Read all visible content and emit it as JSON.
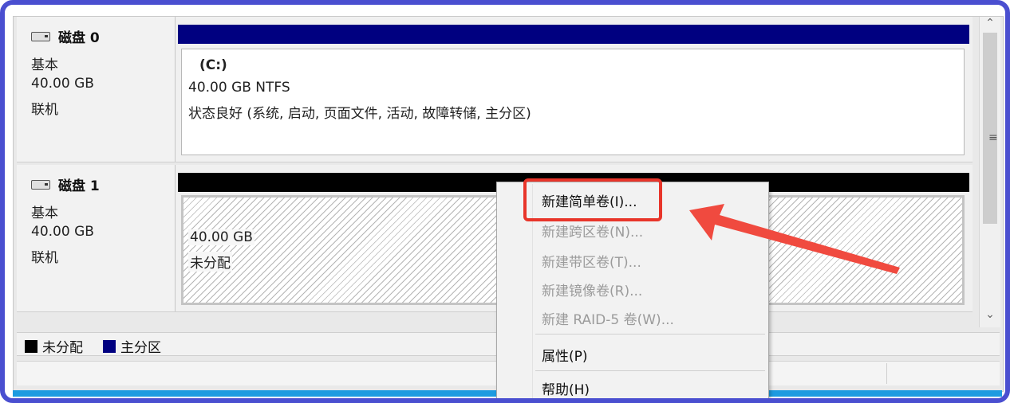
{
  "disks": [
    {
      "title": "磁盘 0",
      "type": "基本",
      "size": "40.00 GB",
      "status": "联机",
      "volume": {
        "name": "(C:)",
        "size_fs": "40.00 GB NTFS",
        "health": "状态良好 (系统, 启动, 页面文件, 活动, 故障转储, 主分区)"
      }
    },
    {
      "title": "磁盘 1",
      "type": "基本",
      "size": "40.00 GB",
      "status": "联机",
      "volume": {
        "size": "40.00 GB",
        "state": "未分配"
      }
    }
  ],
  "legend": [
    {
      "label": "未分配",
      "color": "#000000"
    },
    {
      "label": "主分区",
      "color": "#000080"
    }
  ],
  "context_menu": {
    "items": [
      {
        "label": "新建简单卷(I)...",
        "enabled": true,
        "highlighted": true
      },
      {
        "label": "新建跨区卷(N)...",
        "enabled": false
      },
      {
        "label": "新建带区卷(T)...",
        "enabled": false
      },
      {
        "label": "新建镜像卷(R)...",
        "enabled": false
      },
      {
        "label": "新建 RAID-5 卷(W)...",
        "enabled": false
      },
      {
        "label": "属性(P)",
        "enabled": true
      },
      {
        "label": "帮助(H)",
        "enabled": true
      }
    ]
  },
  "colors": {
    "primary_partition_bar": "#000080",
    "unallocated_bar": "#000000",
    "highlight_box": "#e8352a",
    "annotation_arrow": "#f04a3f",
    "frame_border": "#4a4fd0"
  },
  "icons": [
    "disk-icon",
    "scroll-up-icon",
    "scroll-down-icon",
    "scroll-grip-icon",
    "annotation-arrow-icon"
  ]
}
